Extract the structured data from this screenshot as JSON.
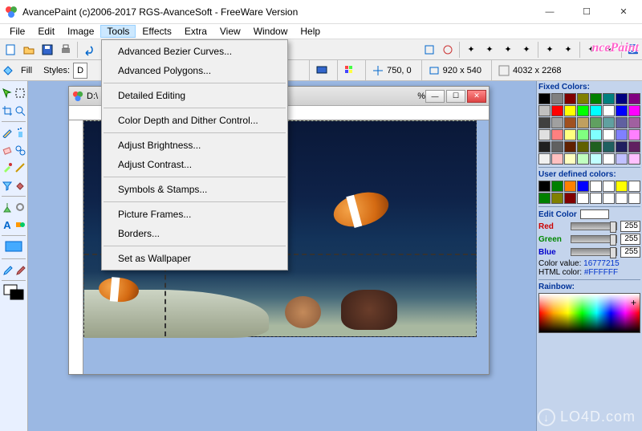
{
  "window": {
    "title": "AvancePaint (c)2006-2017 RGS-AvanceSoft - FreeWare Version"
  },
  "menubar": [
    "File",
    "Edit",
    "Image",
    "Tools",
    "Effects",
    "Extra",
    "View",
    "Window",
    "Help"
  ],
  "active_menu": "Tools",
  "dropdown": [
    {
      "label": "Advanced Bezier Curves..."
    },
    {
      "label": "Advanced Polygons..."
    },
    {
      "sep": true
    },
    {
      "label": "Detailed Editing"
    },
    {
      "sep": true
    },
    {
      "label": "Color Depth and Dither Control..."
    },
    {
      "sep": true
    },
    {
      "label": "Adjust Brightness..."
    },
    {
      "label": "Adjust Contrast..."
    },
    {
      "sep": true
    },
    {
      "label": "Symbols & Stamps..."
    },
    {
      "sep": true
    },
    {
      "label": "Picture Frames..."
    },
    {
      "label": "Borders..."
    },
    {
      "sep": true
    },
    {
      "label": "Set as Wallpaper"
    }
  ],
  "logo_text": "ncePaint",
  "toolbar2": {
    "fill_label": "Fill",
    "styles_label": "Styles:",
    "styles_value": "D",
    "zoom_pct": "%",
    "cursor_pos": "750, 0",
    "image_size": "920 x 540",
    "canvas_size": "4032 x 2268"
  },
  "doc": {
    "title_prefix": "D:\\",
    "win_btns": {
      "min": "—",
      "max": "☐",
      "close": "✕"
    }
  },
  "right": {
    "fixed_label": "Fixed Colors:",
    "fixed_colors": [
      "#000000",
      "#808080",
      "#800000",
      "#808000",
      "#008000",
      "#008080",
      "#000080",
      "#800080",
      "#c0c0c0",
      "#ff0000",
      "#ffff00",
      "#00ff00",
      "#00ffff",
      "#ffffff",
      "#0000ff",
      "#ff00ff",
      "#404040",
      "#a0a0a0",
      "#a05020",
      "#c0a060",
      "#60a060",
      "#60a0a0",
      "#6060a0",
      "#a060a0",
      "#e0e0e0",
      "#ff8080",
      "#ffff80",
      "#80ff80",
      "#80ffff",
      "#ffffff",
      "#8080ff",
      "#ff80ff",
      "#202020",
      "#606060",
      "#602000",
      "#606000",
      "#206020",
      "#206060",
      "#202060",
      "#602060",
      "#f0f0f0",
      "#ffc0c0",
      "#ffffc0",
      "#c0ffc0",
      "#c0ffff",
      "#ffffff",
      "#c0c0ff",
      "#ffc0ff"
    ],
    "user_label": "User defined colors:",
    "user_colors": [
      "#000000",
      "#008000",
      "#ff8000",
      "#0000ff",
      "#ffffff",
      "#ffffff",
      "#ffff00",
      "#ffffff",
      "#008000",
      "#808000",
      "#800000",
      "#ffffff",
      "#ffffff",
      "#ffffff",
      "#ffffff",
      "#ffffff"
    ],
    "edit_label": "Edit Color",
    "r_label": "Red",
    "g_label": "Green",
    "b_label": "Blue",
    "r_val": "255",
    "g_val": "255",
    "b_val": "255",
    "colorvalue_label": "Color value:",
    "colorvalue": "16777215",
    "htmlcolor_label": "HTML color:",
    "htmlcolor": "#FFFFFF",
    "rainbow_label": "Rainbow:"
  },
  "watermark": "LO4D.com"
}
